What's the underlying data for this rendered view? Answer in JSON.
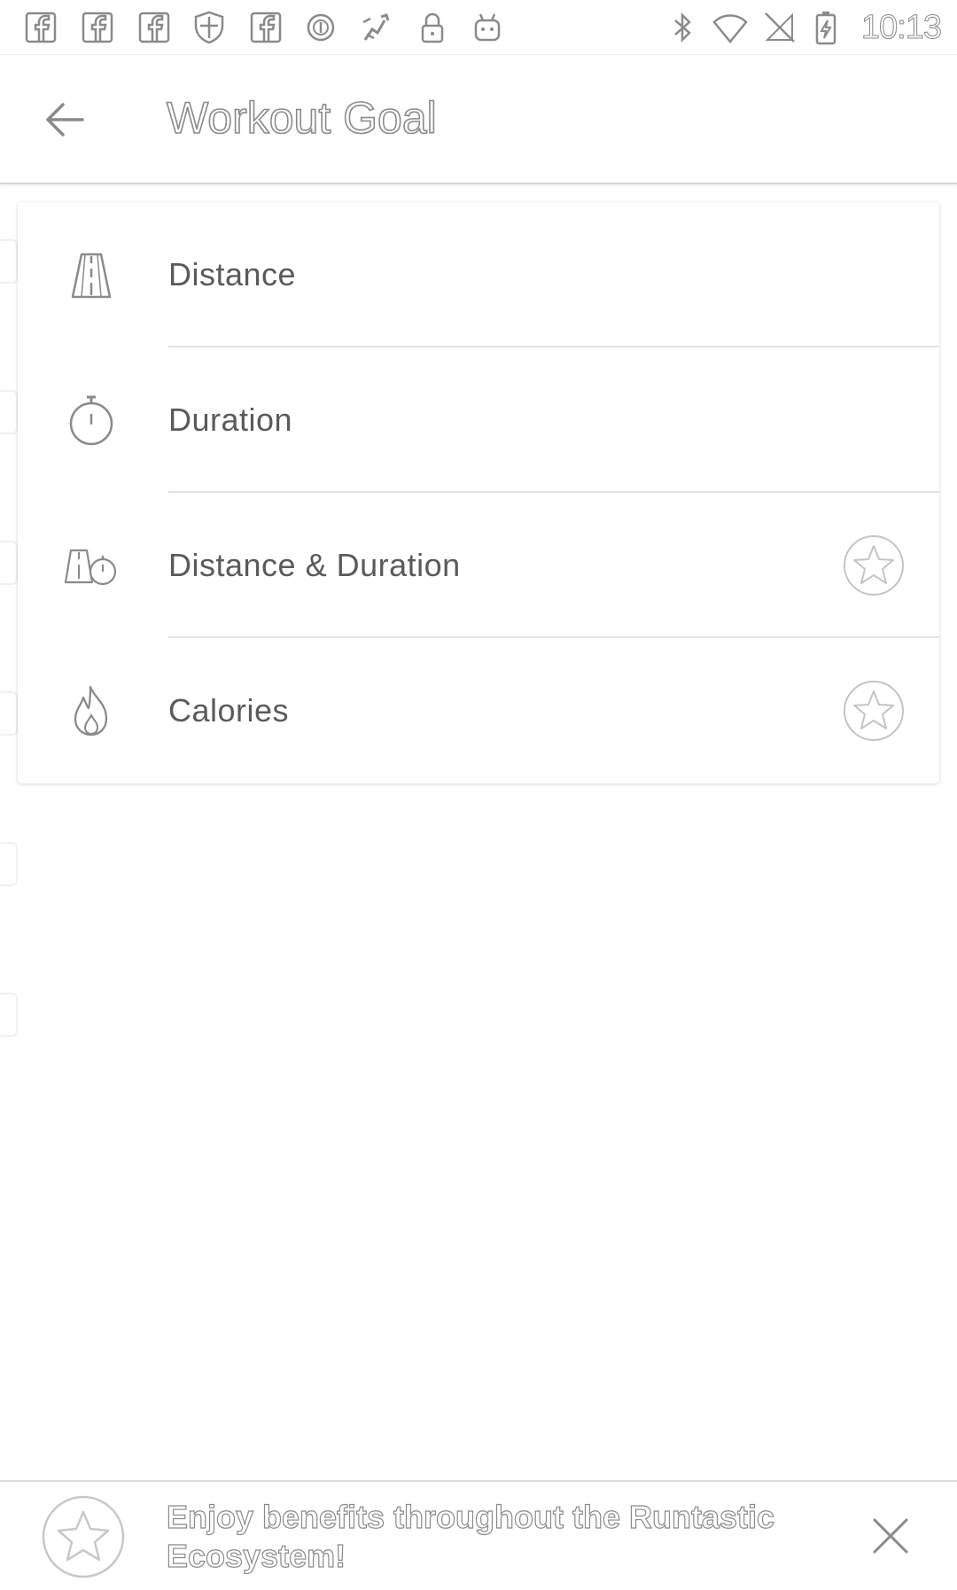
{
  "status_bar": {
    "left_icons": [
      "facebook-icon",
      "facebook-icon",
      "facebook-icon",
      "shield-icon",
      "facebook-icon",
      "circle-app-icon",
      "running-app-icon",
      "lock-icon",
      "android-icon"
    ],
    "right_icons": [
      "bluetooth-icon",
      "wifi-icon",
      "no-signal-icon",
      "battery-charging-icon"
    ],
    "time": "10:13"
  },
  "app_bar": {
    "title": "Workout Goal"
  },
  "goal_options": [
    {
      "label": "Distance",
      "icon": "road-icon",
      "premium": false
    },
    {
      "label": "Duration",
      "icon": "stopwatch-icon",
      "premium": false
    },
    {
      "label": "Distance & Duration",
      "icon": "road-stopwatch-icon",
      "premium": true
    },
    {
      "label": "Calories",
      "icon": "flame-icon",
      "premium": true
    }
  ],
  "promo_banner": {
    "text": "Enjoy benefits throughout the Runtastic Ecosystem!",
    "icon": "star-icon"
  },
  "colors": {
    "background": "#ffffff",
    "icon_gray": "#8a8a8a",
    "divider": "#e2e2e2"
  }
}
